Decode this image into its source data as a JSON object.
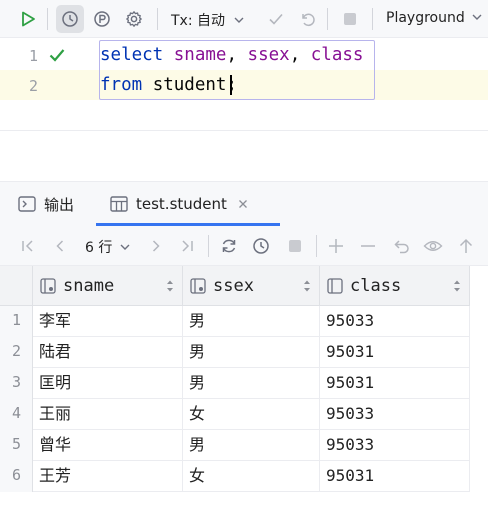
{
  "toolbar": {
    "tx_label": "Tx: 自动",
    "playground_label": "Playground",
    "colors": {
      "run": "#2ea043",
      "muted": "#a8abb2"
    }
  },
  "editor": {
    "line_numbers": [
      "1",
      "2"
    ],
    "line1": {
      "kw": "select",
      "cols": [
        "sname",
        "ssex",
        "class"
      ],
      "sep": ", "
    },
    "line2": {
      "kw": "from",
      "table": "student",
      "end": ";"
    }
  },
  "results": {
    "tabs": [
      {
        "label": "输出"
      },
      {
        "label": "test.student"
      }
    ],
    "rows_label": "6 行",
    "columns": [
      "sname",
      "ssex",
      "class"
    ],
    "rows": [
      {
        "n": "1",
        "sname": "李军",
        "ssex": "男",
        "class": "95033"
      },
      {
        "n": "2",
        "sname": "陆君",
        "ssex": "男",
        "class": "95031"
      },
      {
        "n": "3",
        "sname": "匡明",
        "ssex": "男",
        "class": "95031"
      },
      {
        "n": "4",
        "sname": "王丽",
        "ssex": "女",
        "class": "95033"
      },
      {
        "n": "5",
        "sname": "曾华",
        "ssex": "男",
        "class": "95033"
      },
      {
        "n": "6",
        "sname": "王芳",
        "ssex": "女",
        "class": "95031"
      }
    ]
  }
}
